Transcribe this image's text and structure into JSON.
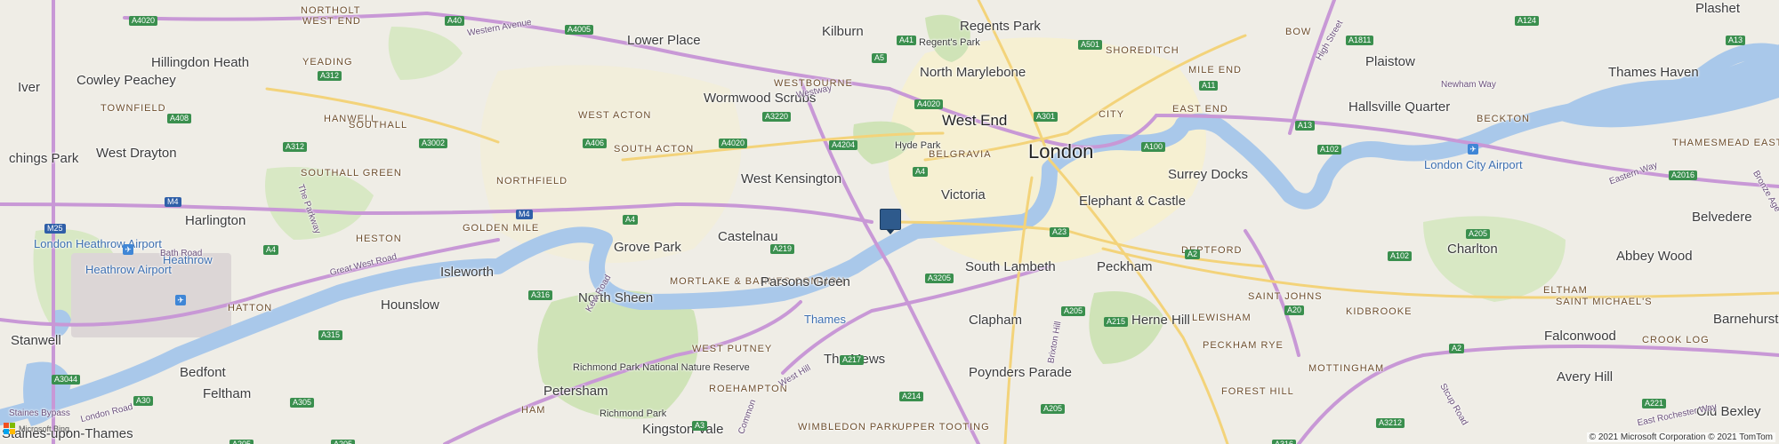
{
  "map": {
    "copyright": "© 2021 Microsoft Corporation © 2021 TomTom",
    "logo_text": "Microsoft Bing",
    "colors": {
      "water": "#a9c8ea",
      "park": "#cfe3b7",
      "urban": "#f6efcf",
      "motorway": "#c898d6",
      "primary": "#f3d37a",
      "land": "#efede6",
      "marker": "#2e5a8c"
    },
    "marker": {
      "icon": "location-pin-icon",
      "label": ""
    },
    "places": [
      {
        "name": "Northolt",
        "kind": "district"
      },
      {
        "name": "West End",
        "kind": "district"
      },
      {
        "name": "Hillingdon Heath",
        "kind": "place"
      },
      {
        "name": "Yeading",
        "kind": "district"
      },
      {
        "name": "Lower Place",
        "kind": "place"
      },
      {
        "name": "Kilburn",
        "kind": "place"
      },
      {
        "name": "Regents Park",
        "kind": "place"
      },
      {
        "name": "Regent's Park",
        "kind": "small"
      },
      {
        "name": "Shoreditch",
        "kind": "district"
      },
      {
        "name": "Bow",
        "kind": "district"
      },
      {
        "name": "Plashet",
        "kind": "place"
      },
      {
        "name": "Iver",
        "kind": "place"
      },
      {
        "name": "Cowley Peachey",
        "kind": "place"
      },
      {
        "name": "Hanwell",
        "kind": "district"
      },
      {
        "name": "Wormwood Scrubs",
        "kind": "place"
      },
      {
        "name": "Westbourne",
        "kind": "district"
      },
      {
        "name": "North Marylebone",
        "kind": "place"
      },
      {
        "name": "Mile End",
        "kind": "district"
      },
      {
        "name": "Plaistow",
        "kind": "place"
      },
      {
        "name": "Thames Haven",
        "kind": "place"
      },
      {
        "name": "Townfield",
        "kind": "district"
      },
      {
        "name": "Southall",
        "kind": "district"
      },
      {
        "name": "West Acton",
        "kind": "district"
      },
      {
        "name": "West End",
        "kind": "city"
      },
      {
        "name": "City",
        "kind": "district"
      },
      {
        "name": "East End",
        "kind": "district"
      },
      {
        "name": "Hallsville Quarter",
        "kind": "place"
      },
      {
        "name": "Beckton",
        "kind": "district"
      },
      {
        "name": "West Drayton",
        "kind": "place"
      },
      {
        "name": "South Acton",
        "kind": "district"
      },
      {
        "name": "Hyde Park",
        "kind": "small"
      },
      {
        "name": "Belgravia",
        "kind": "district"
      },
      {
        "name": "London",
        "kind": "big"
      },
      {
        "name": "Thamesmead East",
        "kind": "district"
      },
      {
        "name": "chings Park",
        "kind": "place"
      },
      {
        "name": "Southall Green",
        "kind": "district"
      },
      {
        "name": "Northfield",
        "kind": "district"
      },
      {
        "name": "West Kensington",
        "kind": "place"
      },
      {
        "name": "Surrey Docks",
        "kind": "place"
      },
      {
        "name": "London City Airport",
        "kind": "water"
      },
      {
        "name": "Victoria",
        "kind": "place"
      },
      {
        "name": "Elephant & Castle",
        "kind": "place"
      },
      {
        "name": "Harlington",
        "kind": "place"
      },
      {
        "name": "Golden Mile",
        "kind": "district"
      },
      {
        "name": "Grove Park",
        "kind": "place"
      },
      {
        "name": "Castelnau",
        "kind": "place"
      },
      {
        "name": "Belvedere",
        "kind": "place"
      },
      {
        "name": "London Heathrow Airport",
        "kind": "water"
      },
      {
        "name": "Heston",
        "kind": "district"
      },
      {
        "name": "Deptford",
        "kind": "district"
      },
      {
        "name": "Charlton",
        "kind": "place"
      },
      {
        "name": "Abbey Wood",
        "kind": "place"
      },
      {
        "name": "Heathrow Airport",
        "kind": "water"
      },
      {
        "name": "Heathrow",
        "kind": "water"
      },
      {
        "name": "Isleworth",
        "kind": "place"
      },
      {
        "name": "Mortlake & Barnes Common",
        "kind": "district"
      },
      {
        "name": "Parsons Green",
        "kind": "place"
      },
      {
        "name": "South Lambeth",
        "kind": "place"
      },
      {
        "name": "Peckham",
        "kind": "place"
      },
      {
        "name": "Hatton",
        "kind": "district"
      },
      {
        "name": "North Sheen",
        "kind": "place"
      },
      {
        "name": "Saint Johns",
        "kind": "district"
      },
      {
        "name": "Kidbrooke",
        "kind": "district"
      },
      {
        "name": "Eltham",
        "kind": "district"
      },
      {
        "name": "Saint Michael's",
        "kind": "district"
      },
      {
        "name": "Hounslow",
        "kind": "place"
      },
      {
        "name": "Thames",
        "kind": "water"
      },
      {
        "name": "Clapham",
        "kind": "place"
      },
      {
        "name": "Herne Hill",
        "kind": "place"
      },
      {
        "name": "Lewisham",
        "kind": "district"
      },
      {
        "name": "Peckham Rye",
        "kind": "district"
      },
      {
        "name": "Stanwell",
        "kind": "place"
      },
      {
        "name": "West Putney",
        "kind": "district"
      },
      {
        "name": "The Mews",
        "kind": "place"
      },
      {
        "name": "Falconwood",
        "kind": "place"
      },
      {
        "name": "Crook Log",
        "kind": "district"
      },
      {
        "name": "Barnehurst",
        "kind": "place"
      },
      {
        "name": "Richmond Park National Nature Reserve",
        "kind": "small"
      },
      {
        "name": "Bedfont",
        "kind": "place"
      },
      {
        "name": "Poynders Parade",
        "kind": "place"
      },
      {
        "name": "Mottingham",
        "kind": "district"
      },
      {
        "name": "Avery Hill",
        "kind": "place"
      },
      {
        "name": "Petersham",
        "kind": "place"
      },
      {
        "name": "Richmond Park",
        "kind": "small"
      },
      {
        "name": "Roehampton",
        "kind": "district"
      },
      {
        "name": "Forest Hill",
        "kind": "district"
      },
      {
        "name": "Feltham",
        "kind": "place"
      },
      {
        "name": "Ham",
        "kind": "district"
      },
      {
        "name": "Old Bexley",
        "kind": "place"
      },
      {
        "name": "Staines-upon-Thames",
        "kind": "place"
      },
      {
        "name": "Kingston Vale",
        "kind": "place"
      },
      {
        "name": "Wimbledon Park",
        "kind": "district"
      },
      {
        "name": "Upper Tooting",
        "kind": "district"
      }
    ],
    "roads": [
      {
        "name": "Western Avenue"
      },
      {
        "name": "Westway"
      },
      {
        "name": "Great West Road"
      },
      {
        "name": "Bath Road"
      },
      {
        "name": "The Parkway"
      },
      {
        "name": "Kew Road"
      },
      {
        "name": "Staines Bypass"
      },
      {
        "name": "London Road"
      },
      {
        "name": "West Hill"
      },
      {
        "name": "Common"
      },
      {
        "name": "Brixton Hill"
      },
      {
        "name": "Stcup Road"
      },
      {
        "name": "Eastern Way"
      },
      {
        "name": "Newham Way"
      },
      {
        "name": "High Street"
      },
      {
        "name": "East Rochester Way"
      },
      {
        "name": "Bronze Age"
      }
    ],
    "shields": [
      {
        "ref": "A4020",
        "kind": "green"
      },
      {
        "ref": "A40",
        "kind": "green"
      },
      {
        "ref": "A4005",
        "kind": "green"
      },
      {
        "ref": "A41",
        "kind": "green"
      },
      {
        "ref": "A5",
        "kind": "green"
      },
      {
        "ref": "A501",
        "kind": "green"
      },
      {
        "ref": "A1811",
        "kind": "green"
      },
      {
        "ref": "A124",
        "kind": "green"
      },
      {
        "ref": "A13",
        "kind": "green"
      },
      {
        "ref": "A312",
        "kind": "green"
      },
      {
        "ref": "A408",
        "kind": "green"
      },
      {
        "ref": "A4020",
        "kind": "green"
      },
      {
        "ref": "A3220",
        "kind": "green"
      },
      {
        "ref": "A301",
        "kind": "green"
      },
      {
        "ref": "A11",
        "kind": "green"
      },
      {
        "ref": "A13",
        "kind": "green"
      },
      {
        "ref": "A4020",
        "kind": "green"
      },
      {
        "ref": "A3002",
        "kind": "green"
      },
      {
        "ref": "A406",
        "kind": "green"
      },
      {
        "ref": "A4204",
        "kind": "green"
      },
      {
        "ref": "A100",
        "kind": "green"
      },
      {
        "ref": "A102",
        "kind": "green"
      },
      {
        "ref": "A312",
        "kind": "green"
      },
      {
        "ref": "A4",
        "kind": "green"
      },
      {
        "ref": "A2016",
        "kind": "green"
      },
      {
        "ref": "M4",
        "kind": "blue"
      },
      {
        "ref": "M25",
        "kind": "blue"
      },
      {
        "ref": "M4",
        "kind": "blue"
      },
      {
        "ref": "A4",
        "kind": "green"
      },
      {
        "ref": "A23",
        "kind": "green"
      },
      {
        "ref": "A205",
        "kind": "green"
      },
      {
        "ref": "A4",
        "kind": "green"
      },
      {
        "ref": "A219",
        "kind": "green"
      },
      {
        "ref": "A2",
        "kind": "green"
      },
      {
        "ref": "A102",
        "kind": "green"
      },
      {
        "ref": "A3205",
        "kind": "green"
      },
      {
        "ref": "A205",
        "kind": "green"
      },
      {
        "ref": "A20",
        "kind": "green"
      },
      {
        "ref": "A316",
        "kind": "green"
      },
      {
        "ref": "A315",
        "kind": "green"
      },
      {
        "ref": "A217",
        "kind": "green"
      },
      {
        "ref": "A215",
        "kind": "green"
      },
      {
        "ref": "A2",
        "kind": "green"
      },
      {
        "ref": "A3044",
        "kind": "green"
      },
      {
        "ref": "A30",
        "kind": "green"
      },
      {
        "ref": "A305",
        "kind": "green"
      },
      {
        "ref": "A214",
        "kind": "green"
      },
      {
        "ref": "A205",
        "kind": "green"
      },
      {
        "ref": "A221",
        "kind": "green"
      },
      {
        "ref": "A3212",
        "kind": "green"
      },
      {
        "ref": "A3",
        "kind": "green"
      },
      {
        "ref": "A205",
        "kind": "green"
      },
      {
        "ref": "A205",
        "kind": "green"
      },
      {
        "ref": "A316",
        "kind": "green"
      }
    ]
  }
}
